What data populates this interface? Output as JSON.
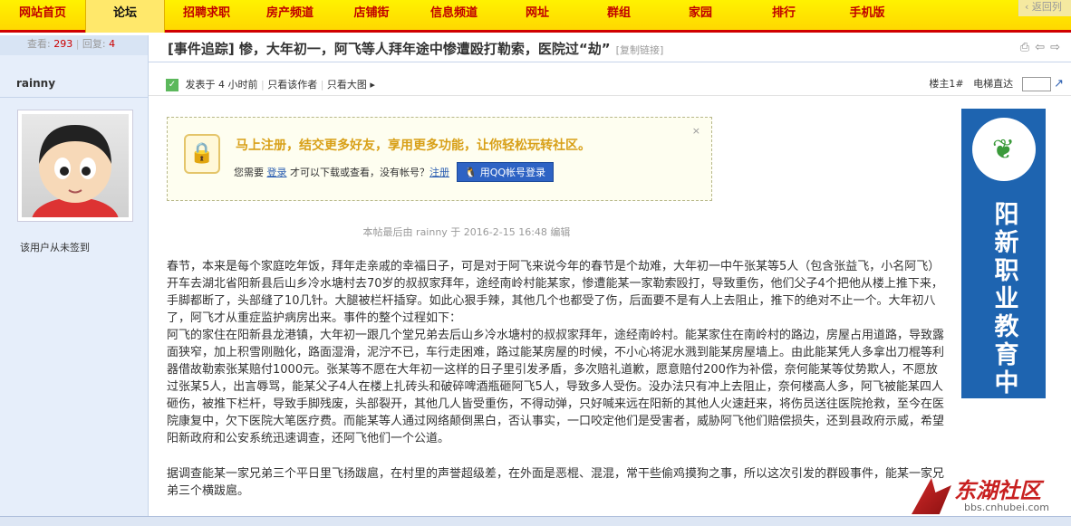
{
  "nav": {
    "items": [
      "网站首页",
      "论坛",
      "招聘求职",
      "房产频道",
      "店铺街",
      "信息频道",
      "网址",
      "群组",
      "家园",
      "排行",
      "手机版"
    ],
    "active": "论坛",
    "back_label": "返回列"
  },
  "thread": {
    "views_label": "查看:",
    "views": "293",
    "replies_label": "回复:",
    "replies": "4",
    "title": "[事件追踪] 惨，大年初一，阿飞等人拜年途中惨遭殴打勒索，医院过“劫”",
    "copy_link": "[复制链接]"
  },
  "author": {
    "name": "rainny",
    "signin_status": "该用户从未签到"
  },
  "post_meta": {
    "posted": "发表于 4 小时前",
    "only_author": "只看该作者",
    "large_image": "只看大图",
    "floor": "楼主1#",
    "jump": "电梯直达"
  },
  "login_prompt": {
    "headline": "马上注册，结交更多好友，享用更多功能，让你轻松玩转社区。",
    "need": "您需要",
    "login": "登录",
    "then": "才可以下载或查看，没有帐号？",
    "register": "注册",
    "qq_button": "用QQ帐号登录",
    "close": "×"
  },
  "edit_note": "本帖最后由 rainny 于 2016-2-15 16:48 编辑",
  "content": {
    "p1": "春节，本来是每个家庭吃年饭，拜年走亲戚的幸福日子，可是对于阿飞来说今年的春节是个劫难，大年初一中午张某等5人（包含张益飞，小名阿飞）开车去湖北省阳新县后山乡冷水塘村去70岁的叔叔家拜年，途经南岭村能某家，惨遭能某一家勒索殴打，导致重伤，他们父子4个把他从楼上推下来，手脚都断了，头部缝了10几针。大腿被栏杆插穿。如此心狠手辣，其他几个也都受了伤，后面要不是有人上去阻止，推下的绝对不止一个。大年初八了，阿飞才从重症监护病房出来。事件的整个过程如下：",
    "p2": "阿飞的家住在阳新县龙港镇，大年初一跟几个堂兄弟去后山乡冷水塘村的叔叔家拜年，途经南岭村。能某家住在南岭村的路边，房屋占用道路，导致露面狭窄，加上积雪刚融化，路面湿滑，泥泞不已，车行走困难，路过能某房屋的时候，不小心将泥水溅到能某房屋墙上。由此能某凭人多拿出刀棍等利器借故勒索张某赔付1000元。张某等不愿在大年初一这样的日子里引发矛盾，多次赔礼道歉，愿意赔付200作为补偿，奈何能某等仗势欺人，不愿放过张某5人，出言辱骂，能某父子4人在楼上扎砖头和破碎啤酒瓶砸阿飞5人，导致多人受伤。没办法只有冲上去阻止，奈何楼高人多，阿飞被能某四人砸伤，被推下栏杆，导致手脚残废，头部裂开，其他几人皆受重伤，不得动弹，只好喊来远在阳新的其他人火速赶来，将伤员送往医院抢救，至今在医院康复中，欠下医院大笔医疗费。而能某等人通过网络颠倒黑白，否认事实，一口咬定他们是受害者，威胁阿飞他们赔偿损失，还到县政府示威，希望阳新政府和公安系统迅速调查，还阿飞他们一个公道。",
    "p3": "据调查能某一家兄弟三个平日里飞扬跋扈，在村里的声誉超级差，在外面是恶棍、混混，常干些偷鸡摸狗之事，所以这次引发的群殴事件，能某一家兄弟三个横跋扈。"
  },
  "ad": {
    "text": "阳新职业教育中心"
  },
  "watermark": {
    "brand": "东湖社区",
    "url": "bbs.cnhubei.com"
  }
}
